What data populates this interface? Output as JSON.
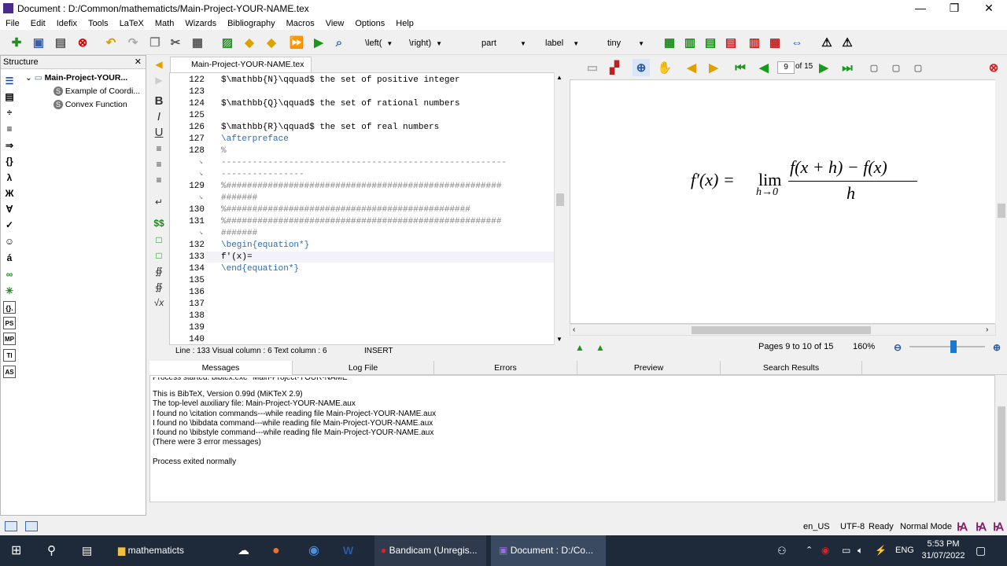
{
  "window": {
    "title": "Document : D:/Common/mathematicts/Main-Project-YOUR-NAME.tex",
    "minimize": "—",
    "maximize": "❐",
    "close": "✕"
  },
  "menu": [
    "File",
    "Edit",
    "Idefix",
    "Tools",
    "LaTeX",
    "Math",
    "Wizards",
    "Bibliography",
    "Macros",
    "View",
    "Options",
    "Help"
  ],
  "toolbar": {
    "left_combo": "\\left(",
    "right_combo": "\\right)",
    "part_combo": "part",
    "label_combo": "label",
    "size_combo": "tiny"
  },
  "structure": {
    "header": "Structure",
    "close": "✕",
    "root": "Main-Project-YOUR...",
    "items": [
      "Example of Coordi...",
      "Convex Function"
    ]
  },
  "left_symbols": [
    "☰",
    "▤",
    "÷",
    "≡",
    "⇒",
    "{}",
    "λ",
    "Ж",
    "∀",
    "✓",
    "☺",
    "á",
    "∞",
    "✳",
    "{}.",
    "PS",
    "MP",
    "TI",
    "AS"
  ],
  "format_symbols": [
    "B",
    "I",
    "U",
    "≡",
    "≡",
    "≡",
    "↵",
    "$$",
    "□",
    "□",
    "∯",
    "∯",
    "√x"
  ],
  "editor": {
    "tab_label": "Main-Project-YOUR-NAME.tex",
    "tab_close": "✕",
    "lines": [
      {
        "n": "122",
        "text": "$\\mathbb{N}\\qquad$ the set of positive integer",
        "cls": ""
      },
      {
        "n": "123",
        "text": "",
        "cls": ""
      },
      {
        "n": "124",
        "text": "$\\mathbb{Q}\\qquad$ the set of rational numbers",
        "cls": ""
      },
      {
        "n": "125",
        "text": "",
        "cls": ""
      },
      {
        "n": "126",
        "text": "$\\mathbb{R}\\qquad$ the set of real numbers",
        "cls": ""
      },
      {
        "n": "127",
        "text": "\\afterpreface",
        "cls": "kw"
      },
      {
        "n": "128",
        "text": "%",
        "cls": "cmt"
      },
      {
        "n": "",
        "text": "-------------------------------------------------------",
        "cls": "cmt"
      },
      {
        "n": "",
        "text": "----------------",
        "cls": "cmt"
      },
      {
        "n": "129",
        "text": "%#####################################################",
        "cls": "cmt"
      },
      {
        "n": "",
        "text": "#######",
        "cls": "cmt"
      },
      {
        "n": "130",
        "text": "%###############################################",
        "cls": "cmt"
      },
      {
        "n": "131",
        "text": "%#####################################################",
        "cls": "cmt"
      },
      {
        "n": "",
        "text": "#######",
        "cls": "cmt"
      },
      {
        "n": "132",
        "text": "\\begin{equation*}",
        "cls": "kw"
      },
      {
        "n": "133",
        "text": "f'(x)=",
        "cls": ""
      },
      {
        "n": "134",
        "text": "\\end{equation*}",
        "cls": "kw"
      },
      {
        "n": "135",
        "text": "",
        "cls": ""
      },
      {
        "n": "136",
        "text": "",
        "cls": ""
      },
      {
        "n": "137",
        "text": "",
        "cls": ""
      },
      {
        "n": "138",
        "text": "",
        "cls": ""
      },
      {
        "n": "139",
        "text": "",
        "cls": ""
      },
      {
        "n": "140",
        "text": "",
        "cls": ""
      }
    ],
    "status": "Line : 133 Visual column : 6 Text column : 6",
    "mode": "INSERT"
  },
  "pdf": {
    "page_input": "9",
    "page_of": "of 15",
    "pages_label": "Pages 9 to 10 of 15",
    "zoom": "160%",
    "formula": {
      "lhs": "f′(x) = ",
      "lim": "lim",
      "sub": "h→0",
      "num": "f(x + h) − f(x)",
      "den": "h"
    }
  },
  "bottom_tabs": [
    "Messages",
    "Log File",
    "Errors",
    "Preview",
    "Search Results"
  ],
  "messages": [
    "Process started: bibtex.exe \"Main-Project-YOUR-NAME\"",
    "",
    "This is BibTeX, Version 0.99d (MiKTeX 2.9)",
    "The top-level auxiliary file: Main-Project-YOUR-NAME.aux",
    "I found no \\citation commands---while reading file Main-Project-YOUR-NAME.aux",
    "I found no \\bibdata command---while reading file Main-Project-YOUR-NAME.aux",
    "I found no \\bibstyle command---while reading file Main-Project-YOUR-NAME.aux",
    "(There were 3 error messages)",
    "",
    "Process exited normally"
  ],
  "statusbar": {
    "lang": "en_US",
    "encoding": "UTF-8",
    "ready": "Ready",
    "mode": "Normal Mode"
  },
  "taskbar": {
    "folder": "mathematicts",
    "bandicam": "Bandicam (Unregis...",
    "document": "Document : D:/Co...",
    "ime": "ENG",
    "time": "5:53 PM",
    "date": "31/07/2022"
  },
  "colors": {
    "accent": "#2a6bb5",
    "taskbar": "#1e2a3a",
    "comment": "#808080"
  }
}
